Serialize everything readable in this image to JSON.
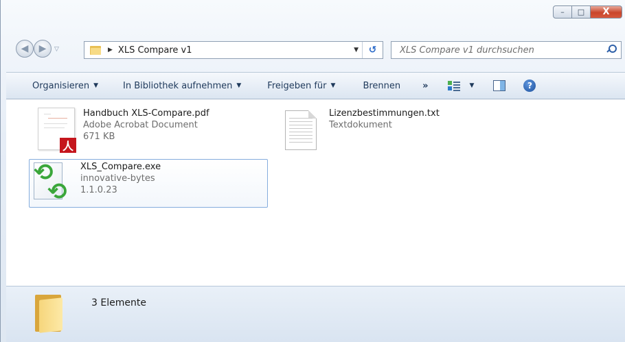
{
  "window": {
    "controls": {
      "minimize": "–",
      "maximize": "□",
      "close": "X"
    }
  },
  "nav": {
    "back_glyph": "◀",
    "forward_glyph": "▶",
    "dropdown_glyph": "▽",
    "breadcrumb_sep": "▶",
    "path": "XLS Compare v1",
    "address_dropdown": "▼",
    "refresh_glyph": "↺"
  },
  "search": {
    "placeholder": "XLS Compare v1 durchsuchen"
  },
  "toolbar": {
    "organize": "Organisieren",
    "library": "In Bibliothek aufnehmen",
    "share": "Freigeben für",
    "burn": "Brennen",
    "more": "»",
    "caret": "▼",
    "help": "?"
  },
  "files": [
    {
      "name": "Handbuch XLS-Compare.pdf",
      "type": "Adobe Acrobat Document",
      "size": "671 KB",
      "icon": "pdf-icon",
      "badge": "人"
    },
    {
      "name": "Lizenzbestimmungen.txt",
      "type": "Textdokument",
      "icon": "text-file-icon"
    },
    {
      "name": "XLS_Compare.exe",
      "company": "innovative-bytes",
      "version": "1.1.0.23",
      "icon": "exe-icon"
    }
  ],
  "status": {
    "count": "3 Elemente"
  },
  "colors": {
    "accent": "#1e395b",
    "selection_border": "#84acdd",
    "close_button": "#c9462c"
  }
}
